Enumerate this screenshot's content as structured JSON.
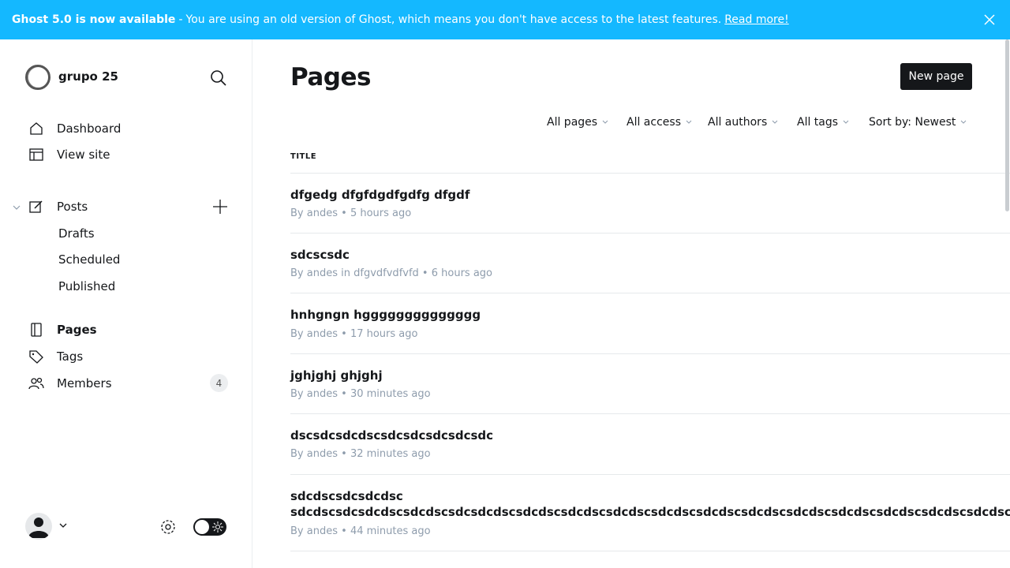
{
  "banner": {
    "title": "Ghost 5.0 is now available",
    "separator": "-",
    "message": "You are using an old version of Ghost, which means you don't have access to the latest features.",
    "link": "Read more!"
  },
  "sidebar": {
    "site_name": "grupo 25",
    "nav": {
      "dashboard": "Dashboard",
      "view_site": "View site",
      "posts": "Posts",
      "drafts": "Drafts",
      "scheduled": "Scheduled",
      "published": "Published",
      "pages": "Pages",
      "tags": "Tags",
      "members": "Members",
      "members_count": "4"
    }
  },
  "main": {
    "title": "Pages",
    "new_button": "New page",
    "filters": [
      "All pages",
      "All access",
      "All authors",
      "All tags",
      "Sort by: Newest"
    ],
    "column_header": "TITLE",
    "rows": [
      {
        "title": "dfgedg dfgfdgdfgdfg dfgdf",
        "by": "By",
        "author": "andes",
        "in": "",
        "tag": "",
        "time": "5 hours ago"
      },
      {
        "title": "sdcscsdc",
        "by": "By",
        "author": "andes",
        "in": "in",
        "tag": "dfgvdfvdfvfd",
        "time": "6 hours ago"
      },
      {
        "title": "hnhgngn hgggggggggggggg",
        "by": "By",
        "author": "andes",
        "in": "",
        "tag": "",
        "time": "17 hours ago"
      },
      {
        "title": "jghjghj ghjghj",
        "by": "By",
        "author": "andes",
        "in": "",
        "tag": "",
        "time": "30 minutes ago"
      },
      {
        "title": "dscsdcsdcdscsdcsdcsdcsdcsdc",
        "by": "By",
        "author": "andes",
        "in": "",
        "tag": "",
        "time": "32 minutes ago"
      },
      {
        "title": "sdcdscsdcsdcdsc",
        "title2": "sdcdscsdcsdcdscsdcdscsdcsdcdscsdcdscsdcdscsdcdscsdcdscsdcdscsdcdscsdcdscsdcdscsdcdscsdcdscsdcdscsdcdscsdcdscsdcdscsdcdscsdcdsc",
        "by": "By",
        "author": "andes",
        "in": "",
        "tag": "",
        "time": "44 minutes ago"
      }
    ]
  },
  "colors": {
    "banner": "#14b8ff",
    "text": "#15171a",
    "meta": "#8e9cac",
    "button": "#15171a"
  }
}
